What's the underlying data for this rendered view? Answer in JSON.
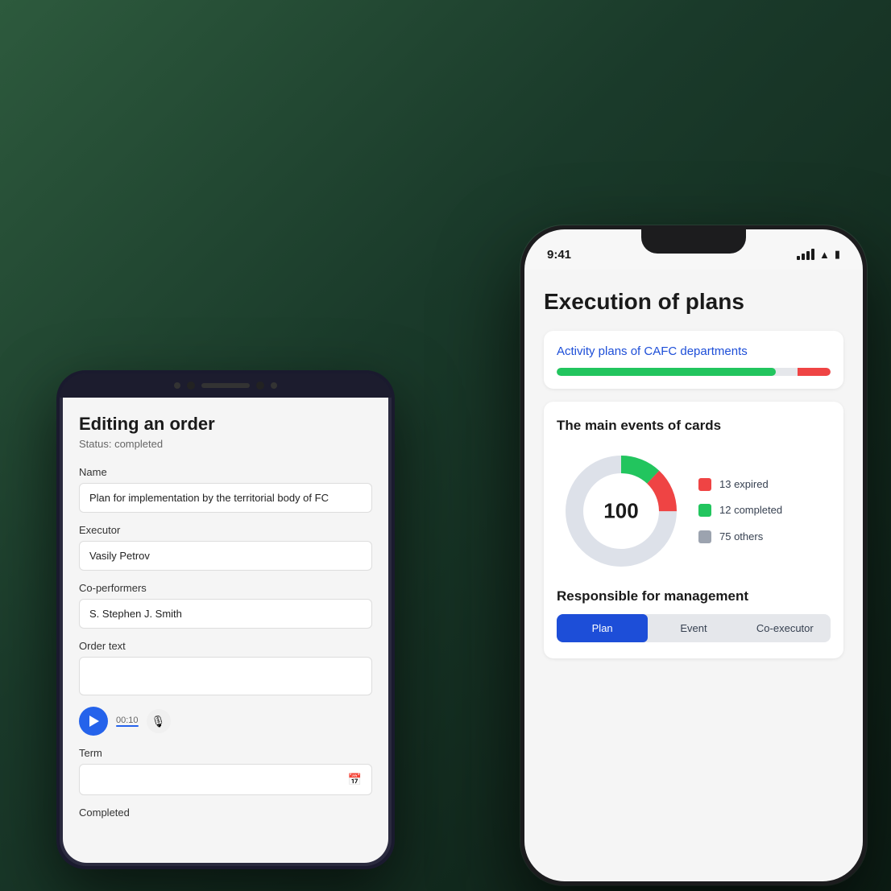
{
  "background": {
    "color_start": "#2d5a3d",
    "color_end": "#0d1f16"
  },
  "android_phone": {
    "title": "Editing an order",
    "status": "Status: completed",
    "fields": {
      "name_label": "Name",
      "name_value": "Plan for implementation by the territorial body of FC",
      "executor_label": "Executor",
      "executor_value": "Vasily Petrov",
      "co_performers_label": "Co-performers",
      "co_performers_value": "S. Stephen  J. Smith",
      "order_text_label": "Order text",
      "order_text_value": "",
      "audio_time": "00:10",
      "term_label": "Term",
      "term_value": "",
      "completed_label": "Completed"
    }
  },
  "iphone": {
    "status_bar": {
      "time": "9:41"
    },
    "app_title": "Execution of plans",
    "activity_card": {
      "title": "Activity plans of CAFC departments",
      "progress_green_pct": 80,
      "progress_red_pct": 12
    },
    "events_card": {
      "title": "The main events of cards",
      "donut_center": "100",
      "legend": [
        {
          "label": "13 expired",
          "color": "red"
        },
        {
          "label": "12 completed",
          "color": "green"
        },
        {
          "label": "75 others",
          "color": "gray"
        }
      ]
    },
    "responsible": {
      "title": "Responsible for management",
      "tabs": [
        {
          "label": "Plan",
          "active": true
        },
        {
          "label": "Event",
          "active": false
        },
        {
          "label": "Co-executor",
          "active": false
        }
      ]
    }
  }
}
